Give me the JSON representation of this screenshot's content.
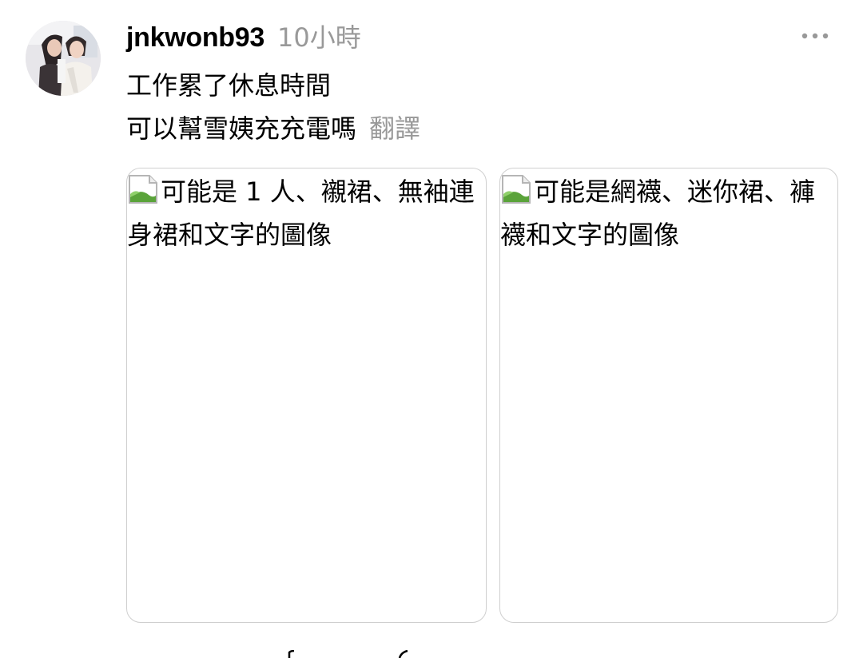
{
  "post": {
    "author": {
      "username": "jnkwonb93"
    },
    "timestamp": "10小時",
    "caption_lines": [
      "工作累了休息時間",
      "可以幫雪姨充充電嗎"
    ],
    "translate_label": "翻譯",
    "more_icon": "more-horizontal-icon"
  },
  "media": [
    {
      "alt": "可能是 1 人、襯裙、無袖連身裙和文字的圖像",
      "icon": "broken-image-icon"
    },
    {
      "alt": "可能是網襪、迷你裙、褲襪和文字的圖像",
      "icon": "broken-image-icon"
    }
  ],
  "colors": {
    "text": "#000000",
    "muted": "#999999",
    "border": "#cfcfcf",
    "background": "#ffffff"
  }
}
